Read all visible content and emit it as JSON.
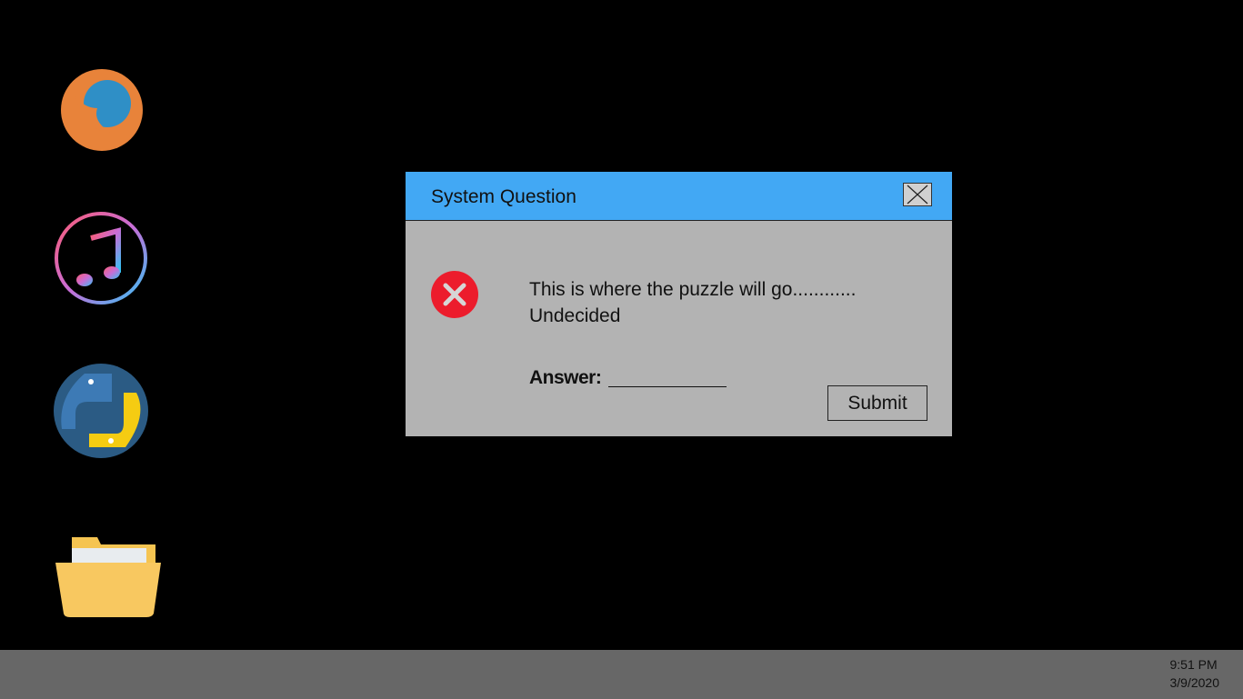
{
  "desktop": {
    "icons": [
      {
        "name": "firefox-icon"
      },
      {
        "name": "itunes-icon"
      },
      {
        "name": "python-icon"
      },
      {
        "name": "folder-icon"
      }
    ]
  },
  "dialog": {
    "title": "System Question",
    "message_line1": "This is where the puzzle will go............",
    "message_line2": "Undecided",
    "answer_label": "Answer:",
    "answer_value": "",
    "submit_label": "Submit",
    "icon": "error-icon",
    "colors": {
      "titlebar": "#42a8f4",
      "body": "#b3b3b3",
      "error": "#ec1c2c"
    }
  },
  "taskbar": {
    "time": "9:51 PM",
    "date": "3/9/2020"
  }
}
